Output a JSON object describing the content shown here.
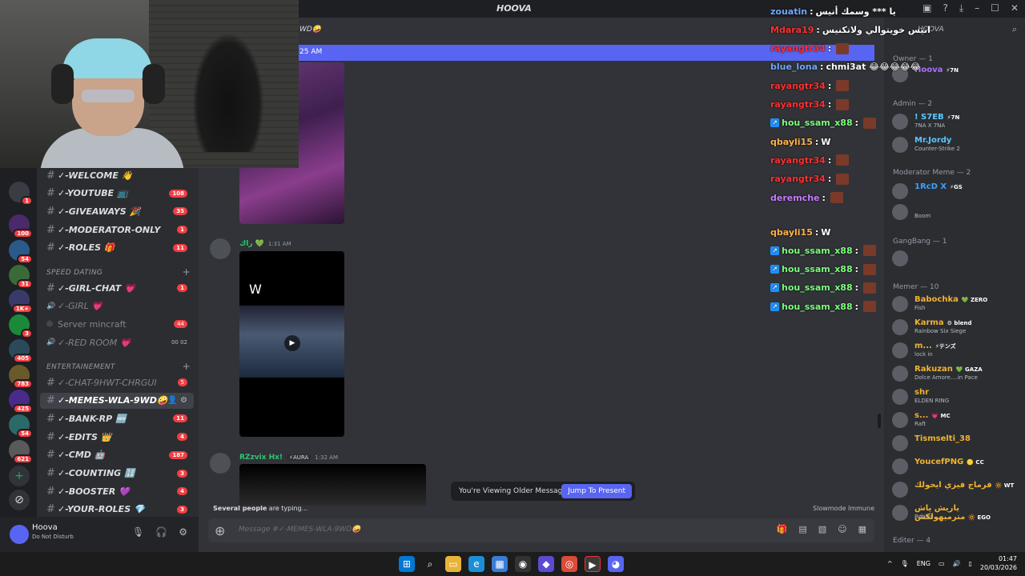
{
  "window": {
    "title": "HOOVA"
  },
  "server_rail": {
    "badges": [
      "1",
      "100",
      "54",
      "31",
      "1K+",
      "3",
      "405",
      "783",
      "425",
      "54",
      "621"
    ]
  },
  "sidebar": {
    "channels_top": [
      {
        "name": "✓-WELCOME 👋",
        "count": ""
      },
      {
        "name": "✓-YOUTUBE 📺",
        "count": "108"
      },
      {
        "name": "✓-GIVEAWAYS 🎉",
        "count": "35"
      },
      {
        "name": "✓-MODERATOR-ONLY",
        "count": "1"
      },
      {
        "name": "✓-ROLES 🎁",
        "count": "11"
      }
    ],
    "cat_speed": "SPEED DATING",
    "speed_channels": [
      {
        "name": "✓-GIRL-CHAT 💗",
        "count": "1",
        "kind": "text"
      },
      {
        "name": "✓-GIRL 💗",
        "count": "",
        "kind": "voice"
      },
      {
        "name": "Server mincraft",
        "count": "44",
        "kind": "stage"
      },
      {
        "name": "✓-RED ROOM 💗",
        "voice": "00  02",
        "kind": "voice"
      }
    ],
    "cat_ent": "ENTERTAINEMENT",
    "ent_channels": [
      {
        "name": "✓-CHAT-9HWT-CHRGUI",
        "count": "5",
        "muted": true
      },
      {
        "name": "✓-MEMES-WLA-9WD🤪",
        "count": "",
        "active": true
      },
      {
        "name": "✓-BANK-RP 🆕",
        "count": "11"
      },
      {
        "name": "✓-EDITS 👑",
        "count": "4"
      },
      {
        "name": "✓-CMD 🤖",
        "count": "187"
      },
      {
        "name": "✓-COUNTING 🔢",
        "count": "3"
      },
      {
        "name": "✓-BOOSTER 💜",
        "count": "4"
      },
      {
        "name": "✓-YOUR-ROLES 💎",
        "count": "3"
      }
    ]
  },
  "user": {
    "name": "Hoova",
    "status": "Do Not Disturb"
  },
  "chat": {
    "channel_title": "WD🤪",
    "new_bar_time": "25 AM",
    "msg1": {
      "author": "راك 💚",
      "time": "1:31 AM"
    },
    "video_overlay": "W",
    "msg2": {
      "author": "RZzvix Hx!",
      "tag": "⚡AURA",
      "time": "1:32 AM"
    },
    "older_text": "You're Viewing Older Messages",
    "jump_button": "Jump To Present",
    "typing": "Several people",
    "typing_suffix": " are typing...",
    "slowmode": "Slowmode Immune",
    "composer_placeholder": "Message #✓-MEMES-WLA-9WD🤪"
  },
  "stream_chat": [
    {
      "user": "zouatin",
      "color": "#6fa8ff",
      "msg": "يا *** وسمك أنيس"
    },
    {
      "user": "Mdara19",
      "color": "#ff3030",
      "msg": "انيس خويتوالي ولاتكنيس"
    },
    {
      "user": "rayangtr34",
      "color": "#ff3030",
      "msg": ""
    },
    {
      "user": "blue_lona",
      "color": "#6fa8ff",
      "msg": "chmi3at 😂😂😂😂😂"
    },
    {
      "user": "rayangtr34",
      "color": "#ff3030",
      "msg": ""
    },
    {
      "user": "rayangtr34",
      "color": "#ff3030",
      "msg": ""
    },
    {
      "user": "hou_ssam_x88",
      "color": "#7dff7d",
      "msg": ""
    },
    {
      "user": "qbayli15",
      "color": "#ffb347",
      "msg": "W"
    },
    {
      "user": "rayangtr34",
      "color": "#ff3030",
      "msg": ""
    },
    {
      "user": "rayangtr34",
      "color": "#ff3030",
      "msg": ""
    },
    {
      "user": "deremche",
      "color": "#c77dff",
      "msg": ""
    },
    {
      "user": "qbayli15",
      "color": "#ffb347",
      "msg": "W"
    },
    {
      "user": "hou_ssam_x88",
      "color": "#7dff7d",
      "msg": ""
    },
    {
      "user": "hou_ssam_x88",
      "color": "#7dff7d",
      "msg": ""
    },
    {
      "user": "hou_ssam_x88",
      "color": "#7dff7d",
      "msg": ""
    },
    {
      "user": "hou_ssam_x88",
      "color": "#7dff7d",
      "msg": ""
    }
  ],
  "members": {
    "search_label": "HOOVA",
    "groups": {
      "owner": "Owner — 1",
      "admin": "Admin — 2",
      "moderator": "Moderator Meme — 2",
      "gangbang": "GangBang — 1",
      "memer": "Memer — 10",
      "editer": "Editer — 4"
    },
    "owner": [
      {
        "name": "Hoova",
        "tag": "⚡7N",
        "act": "",
        "color": "#a970ff"
      }
    ],
    "admin": [
      {
        "name": "! S7EB",
        "tag": "⚡7N",
        "act": "7NA X 7NA",
        "color": "#5ac8ff"
      },
      {
        "name": "Mr.Jordy",
        "tag": "",
        "act": "Counter-Strike 2",
        "color": "#5ac8ff"
      }
    ],
    "moderator": [
      {
        "name": "1RcD X",
        "tag": "⚡GS",
        "act": "",
        "color": "#3aa0ff"
      },
      {
        "name": "",
        "tag": "",
        "act": "Boom",
        "color": "#3aa0ff"
      }
    ],
    "memer": [
      {
        "name": "Babochka",
        "tag": "💚 ZERO",
        "act": "Fish",
        "color": "#f0b232"
      },
      {
        "name": "Karma",
        "tag": "⚙ blend",
        "act": "Rainbow Six Siege",
        "color": "#f0b232"
      },
      {
        "name": "m...",
        "tag": "⚡テンズ",
        "act": "lock in",
        "color": "#f0b232"
      },
      {
        "name": "Rakuzan",
        "tag": "💚 GAZA",
        "act": "Dolce Amore....in Pace",
        "color": "#f0b232"
      },
      {
        "name": "shr",
        "tag": "",
        "act": "ELDEN RING",
        "color": "#f0b232"
      },
      {
        "name": "s...",
        "tag": "💗 MC",
        "act": "Raft",
        "color": "#f0b232"
      },
      {
        "name": "Tismselti_38",
        "tag": "",
        "act": "",
        "color": "#f0b232"
      },
      {
        "name": "YoucefPNG",
        "tag": "🟡 CC",
        "act": "",
        "color": "#f0b232"
      },
      {
        "name": "فرماج فيزي ايحولك",
        "tag": "🔆 WT",
        "act": "",
        "color": "#f0b232"
      },
      {
        "name": "ياريش ياش مترميهولكش",
        "tag": "🔆 EGO",
        "act": "Roblox",
        "color": "#f0b232"
      }
    ]
  },
  "taskbar": {
    "lang": "ENG",
    "time": "01:47",
    "date": "20/03/2026"
  },
  "colors": {
    "accent": "#5865f2",
    "danger": "#f23f43",
    "bg": "#313338"
  }
}
